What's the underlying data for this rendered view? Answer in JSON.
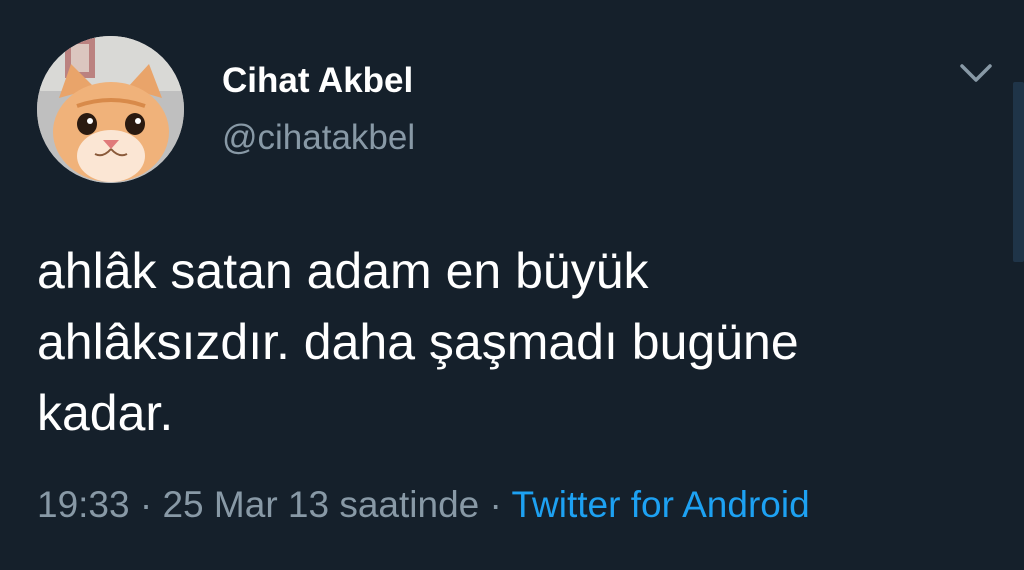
{
  "author": {
    "display_name": "Cihat Akbel",
    "handle": "@cihatakbel",
    "avatar_icon": "orange-cat-photo"
  },
  "tweet": {
    "text": "ahlâk satan adam en büyük\nahlâksızdır. daha şaşmadı bugüne\nkadar."
  },
  "meta": {
    "time": "19:33",
    "separator1": " · ",
    "date": "25 Mar 13 saatinde",
    "separator2": " · ",
    "source": "Twitter for Android"
  },
  "icons": {
    "menu": "chevron-down-icon"
  },
  "colors": {
    "background": "#15202b",
    "primary_text": "#ffffff",
    "secondary_text": "#8899a6",
    "link": "#1da1f2"
  }
}
